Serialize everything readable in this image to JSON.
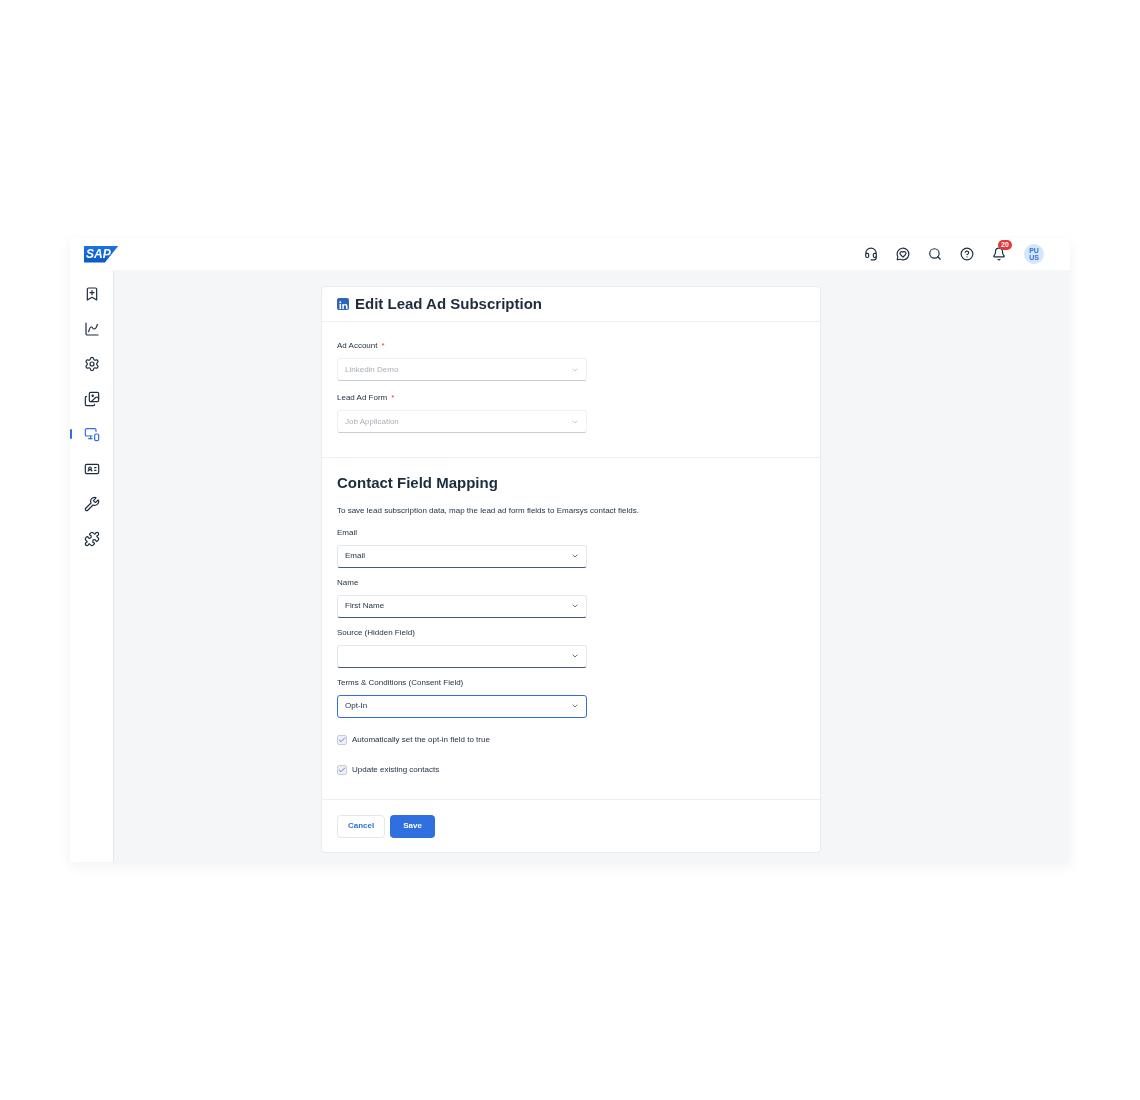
{
  "header": {
    "logo": "SAP",
    "notification_count": "20",
    "avatar": "PU US"
  },
  "sidebar": {
    "items": [
      {
        "selected": false
      },
      {
        "selected": false
      },
      {
        "selected": false
      },
      {
        "selected": false
      },
      {
        "selected": true
      },
      {
        "selected": false
      },
      {
        "selected": false
      },
      {
        "selected": false
      }
    ]
  },
  "dialog": {
    "title": "Edit Lead Ad Subscription",
    "source_fields": [
      {
        "label": "Ad Account",
        "required_mark": "*",
        "value": "Linkedin Demo",
        "disabled": true
      },
      {
        "label": "Lead Ad Form",
        "required_mark": "*",
        "value": "Job Application",
        "disabled": true
      }
    ],
    "mapping": {
      "title": "Contact Field Mapping",
      "description": "To save lead subscription data, map the lead ad form fields to Emarsys contact fields.",
      "fields": [
        {
          "label": "Email",
          "value": "Email",
          "disabled": false,
          "focused": false
        },
        {
          "label": "Name",
          "value": "First Name",
          "disabled": false,
          "focused": false
        },
        {
          "label": "Source (Hidden Field)",
          "disabled": false,
          "focused": false
        },
        {
          "label": "Terms & Conditions (Consent Field)",
          "value": "Opt-In",
          "disabled": false,
          "focused": true
        }
      ],
      "checkboxes": [
        {
          "label": "Automatically set the opt-in field to true",
          "checked": true
        },
        {
          "label": "Update existing contacts",
          "checked": true
        }
      ]
    },
    "buttons": [
      {
        "label": "Cancel",
        "kind": "secondary"
      },
      {
        "label": "Save",
        "kind": "primary"
      }
    ]
  }
}
